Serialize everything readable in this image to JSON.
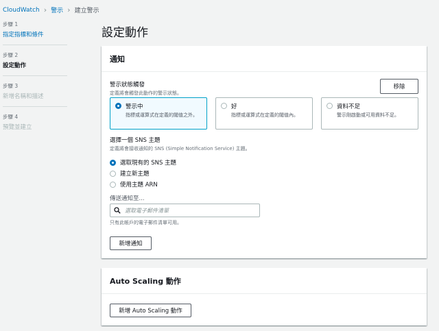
{
  "breadcrumb": {
    "items": [
      "CloudWatch",
      "警示",
      "建立警示"
    ]
  },
  "steps": [
    {
      "num": "步驟 1",
      "title": "指定指標和條件",
      "state": "link"
    },
    {
      "num": "步驟 2",
      "title": "設定動作",
      "state": "active"
    },
    {
      "num": "步驟 3",
      "title": "新增名稱和描述",
      "state": "disabled"
    },
    {
      "num": "步驟 4",
      "title": "預覽並建立",
      "state": "disabled"
    }
  ],
  "page_title": "設定動作",
  "notification": {
    "heading": "通知",
    "trigger_label": "警示狀態觸發",
    "trigger_desc": "定義將會觸發此動作的警示狀態。",
    "remove_label": "移除",
    "states": [
      {
        "title": "警示中",
        "desc": "指標或運算式在定義的閾值之外。",
        "selected": true
      },
      {
        "title": "好",
        "desc": "指標或運算式在定義的閾值內。",
        "selected": false
      },
      {
        "title": "資料不足",
        "desc": "警示剛啟動或可用資料不足。",
        "selected": false
      }
    ],
    "sns_label": "選擇一個 SNS 主題",
    "sns_desc": "定義將會接收通知的 SNS (Simple Notification Service) 主題。",
    "sns_options": [
      {
        "label": "選取現有的 SNS 主題",
        "selected": true
      },
      {
        "label": "建立新主題",
        "selected": false
      },
      {
        "label": "使用主題 ARN",
        "selected": false
      }
    ],
    "send_to_label": "傳送通知至...",
    "search_placeholder": "選取電子郵件清單",
    "search_help": "只有此帳戶的電子郵件清單可用。",
    "add_notification_label": "新增通知"
  },
  "autoscaling": {
    "heading": "Auto Scaling 動作",
    "add_label": "新增 Auto Scaling 動作"
  },
  "colors": {
    "link": "#0073bb",
    "selected_border": "#00a1c9",
    "selected_bg": "#f1faff",
    "page_bg": "#f2f3f3"
  }
}
